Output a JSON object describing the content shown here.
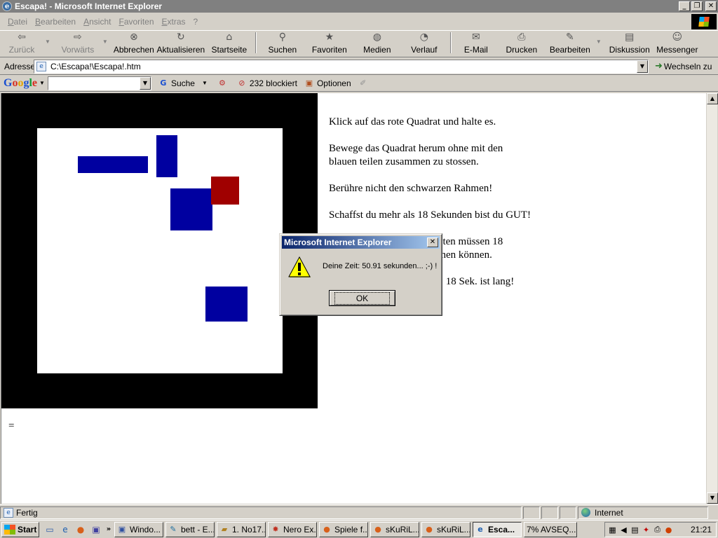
{
  "window": {
    "title": "Escapa! - Microsoft Internet Explorer",
    "minimize_glyph": "_",
    "maximize_glyph": "❐",
    "close_glyph": "✕"
  },
  "menu": [
    "Datei",
    "Bearbeiten",
    "Ansicht",
    "Favoriten",
    "Extras",
    "?"
  ],
  "toolbar": {
    "back": "Zurück",
    "forward": "Vorwärts",
    "stop": "Abbrechen",
    "refresh": "Aktualisieren",
    "home": "Startseite",
    "search": "Suchen",
    "favorites": "Favoriten",
    "media": "Medien",
    "history": "Verlauf",
    "mail": "E-Mail",
    "print": "Drucken",
    "edit": "Bearbeiten",
    "discuss": "Diskussion",
    "messenger": "Messenger"
  },
  "address": {
    "label": "Adresse",
    "value": "C:\\Escapa!\\Escapa!.htm",
    "go": "Wechseln zu"
  },
  "googlebar": {
    "logo": "Google",
    "search_value": "",
    "search_btn": "Suche",
    "blocked": "232 blockiert",
    "options": "Optionen"
  },
  "page": {
    "instructions": [
      "Klick auf das rote Quadrat und halte es.",
      "Bewege das Quadrat herum ohne mit den blauen teilen zusammen zu stossen.",
      "Berühre nicht den schwarzen Rahmen!",
      "Schaffst du mehr als 18 Sekunden bist du GUT!",
      "Ich glaube nicht... Flugpiloten müssen 18 Sekunden ohne fehler machen können.",
      "Los! Versuchs einfach mal. 18 Sek. ist lang!"
    ],
    "footer_text": "="
  },
  "dialog": {
    "title": "Microsoft Internet Explorer",
    "message": "Deine Zeit: 50.91 sekunden... ;-) !",
    "ok": "OK",
    "icon": "warning-icon"
  },
  "status": {
    "text": "Fertig",
    "zone": "Internet"
  },
  "taskbar": {
    "start": "Start",
    "tasks": [
      "Windo...",
      "bett - E...",
      "1. No17...",
      "Nero Ex...",
      "Spiele f...",
      "sKuRiL...",
      "sKuRiL...",
      "Esca...",
      "7% AVSEQ..."
    ],
    "clock": "21:21"
  },
  "colors": {
    "frame": "#000000",
    "blue_block": "#0000a0",
    "red_square": "#a00000"
  }
}
